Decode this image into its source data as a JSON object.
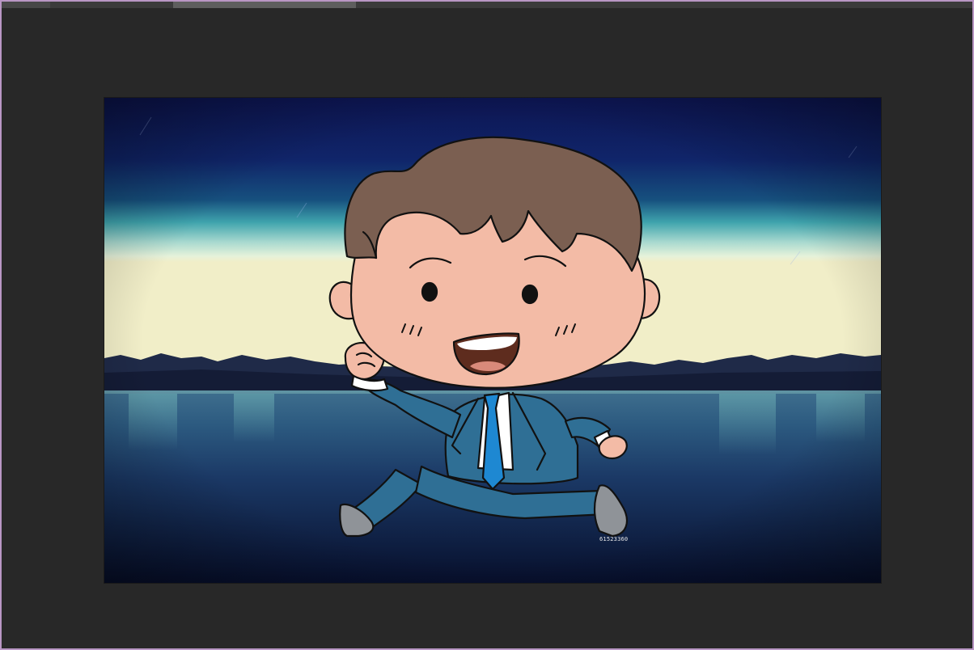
{
  "app": {
    "accent_border": "#b996c4",
    "workspace_bg": "#282828"
  },
  "tabs": [
    {
      "label": ""
    },
    {
      "label": ""
    }
  ],
  "document": {
    "background_scene": "night-lake-mountains",
    "character": "running-cartoon-boy-in-blue-suit",
    "watermark_text": "61523360"
  }
}
